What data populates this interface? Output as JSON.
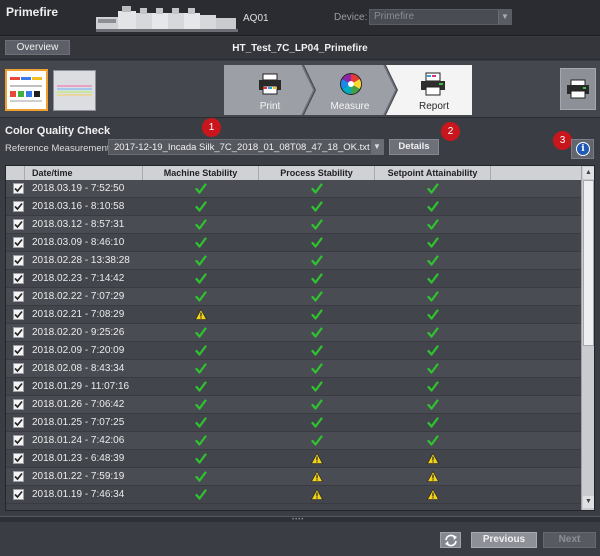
{
  "app": {
    "name": "Primefire",
    "machine_id": "AQ01"
  },
  "device": {
    "label": "Device:",
    "value": "Primefire"
  },
  "overview": {
    "button_label": "Overview",
    "job_title": "HT_Test_7C_LP04_Primefire"
  },
  "steps": [
    {
      "label": "Print",
      "icon": "printer-icon",
      "active": false
    },
    {
      "label": "Measure",
      "icon": "color-wheel-icon",
      "active": false
    },
    {
      "label": "Report",
      "icon": "report-printer-icon",
      "active": true
    }
  ],
  "section": {
    "title": "Color Quality Check",
    "reference_label": "Reference Measurement:",
    "reference_value": "2017-12-19_Incada Silk_7C_2018_01_08T08_47_18_OK.txt",
    "details_label": "Details"
  },
  "badges": [
    "1",
    "2",
    "3"
  ],
  "table": {
    "columns": [
      "Date/time",
      "Machine Stability",
      "Process Stability",
      "Setpoint Attainability"
    ],
    "rows": [
      {
        "date": "2018.03.19 - 7:52:50",
        "machine": "ok",
        "process": "ok",
        "setpoint": "ok"
      },
      {
        "date": "2018.03.16 - 8:10:58",
        "machine": "ok",
        "process": "ok",
        "setpoint": "ok"
      },
      {
        "date": "2018.03.12 - 8:57:31",
        "machine": "ok",
        "process": "ok",
        "setpoint": "ok"
      },
      {
        "date": "2018.03.09 - 8:46:10",
        "machine": "ok",
        "process": "ok",
        "setpoint": "ok"
      },
      {
        "date": "2018.02.28 - 13:38:28",
        "machine": "ok",
        "process": "ok",
        "setpoint": "ok"
      },
      {
        "date": "2018.02.23 - 7:14:42",
        "machine": "ok",
        "process": "ok",
        "setpoint": "ok"
      },
      {
        "date": "2018.02.22 - 7:07:29",
        "machine": "ok",
        "process": "ok",
        "setpoint": "ok"
      },
      {
        "date": "2018.02.21 - 7:08:29",
        "machine": "warn",
        "process": "ok",
        "setpoint": "ok"
      },
      {
        "date": "2018.02.20 - 9:25:26",
        "machine": "ok",
        "process": "ok",
        "setpoint": "ok"
      },
      {
        "date": "2018.02.09 - 7:20:09",
        "machine": "ok",
        "process": "ok",
        "setpoint": "ok"
      },
      {
        "date": "2018.02.08 - 8:43:34",
        "machine": "ok",
        "process": "ok",
        "setpoint": "ok"
      },
      {
        "date": "2018.01.29 - 11:07:16",
        "machine": "ok",
        "process": "ok",
        "setpoint": "ok"
      },
      {
        "date": "2018.01.26 - 7:06:42",
        "machine": "ok",
        "process": "ok",
        "setpoint": "ok"
      },
      {
        "date": "2018.01.25 - 7:07:25",
        "machine": "ok",
        "process": "ok",
        "setpoint": "ok"
      },
      {
        "date": "2018.01.24 - 7:42:06",
        "machine": "ok",
        "process": "ok",
        "setpoint": "ok"
      },
      {
        "date": "2018.01.23 - 6:48:39",
        "machine": "ok",
        "process": "warn",
        "setpoint": "warn"
      },
      {
        "date": "2018.01.22 - 7:59:19",
        "machine": "ok",
        "process": "warn",
        "setpoint": "warn"
      },
      {
        "date": "2018.01.19 - 7:46:34",
        "machine": "ok",
        "process": "warn",
        "setpoint": "warn"
      }
    ]
  },
  "footer": {
    "previous_label": "Previous",
    "next_label": "Next"
  },
  "colors": {
    "ok": "#2ec42e",
    "warn": "#f2d21b",
    "badge": "#c8161c",
    "accent": "#f0a030"
  }
}
